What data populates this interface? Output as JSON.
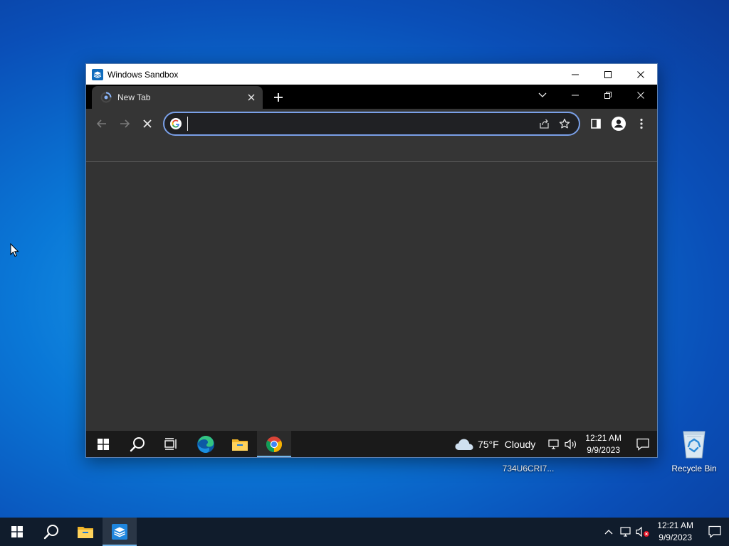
{
  "desktop": {
    "recycle_bin_label": "Recycle Bin",
    "partial_icon_label": "734U6CRI7..."
  },
  "sandbox_window": {
    "title": "Windows Sandbox"
  },
  "browser": {
    "tab_title": "New Tab",
    "omnibox_value": ""
  },
  "inner_taskbar": {
    "weather_temp": "75°F",
    "weather_condition": "Cloudy",
    "clock_time": "12:21 AM",
    "clock_date": "9/9/2023"
  },
  "host_taskbar": {
    "clock_time": "12:21 AM",
    "clock_date": "9/9/2023"
  },
  "colors": {
    "accent_focus": "#7aa0e8",
    "taskbar_active": "#76b9ed",
    "chrome_toolbar": "#353535"
  },
  "icons": [
    "windows-start-icon",
    "search-icon",
    "task-view-icon",
    "edge-icon",
    "file-explorer-icon",
    "chrome-icon",
    "sandbox-icon",
    "cloud-icon",
    "network-icon",
    "volume-icon",
    "notification-icon",
    "recycle-bin-icon"
  ]
}
